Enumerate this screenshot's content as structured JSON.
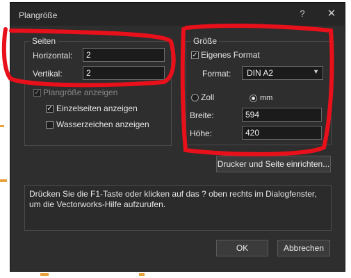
{
  "window": {
    "title": "Plangröße",
    "help_glyph": "?",
    "close_glyph": "✕",
    "help_icon": "question-icon",
    "close_icon": "close-icon"
  },
  "seiten": {
    "legend": "Seiten",
    "horizontal_label": "Horizontal:",
    "horizontal_value": "2",
    "vertikal_label": "Vertikal:",
    "vertikal_value": "2",
    "show_size_label": "Plangröße anzeigen",
    "show_size_checked": true,
    "pages_label": "Einzelseiten anzeigen",
    "pages_checked": true,
    "watermark_label": "Wasserzeichen anzeigen",
    "watermark_checked": false
  },
  "groesse": {
    "legend": "Größe",
    "custom_format_label": "Eigenes Format",
    "custom_format_checked": true,
    "format_label": "Format:",
    "format_value": "DIN A2",
    "unit_zoll_label": "Zoll",
    "unit_mm_label": "mm",
    "unit_selected": "mm",
    "breite_label": "Breite:",
    "breite_value": "594",
    "hoehe_label": "Höhe:",
    "hoehe_value": "420"
  },
  "printer_button_label": "Drucker und Seite einrichten...",
  "hint_text": "Drücken Sie die F1-Taste oder klicken auf das ? oben rechts im Dialogfenster, um die Vectorworks-Hilfe aufzurufen.",
  "ok_label": "OK",
  "cancel_label": "Abbrechen",
  "colors": {
    "annotation": "#e8101a",
    "dialog_bg": "#2e2e2e",
    "accent_orange": "#e8a33d"
  }
}
